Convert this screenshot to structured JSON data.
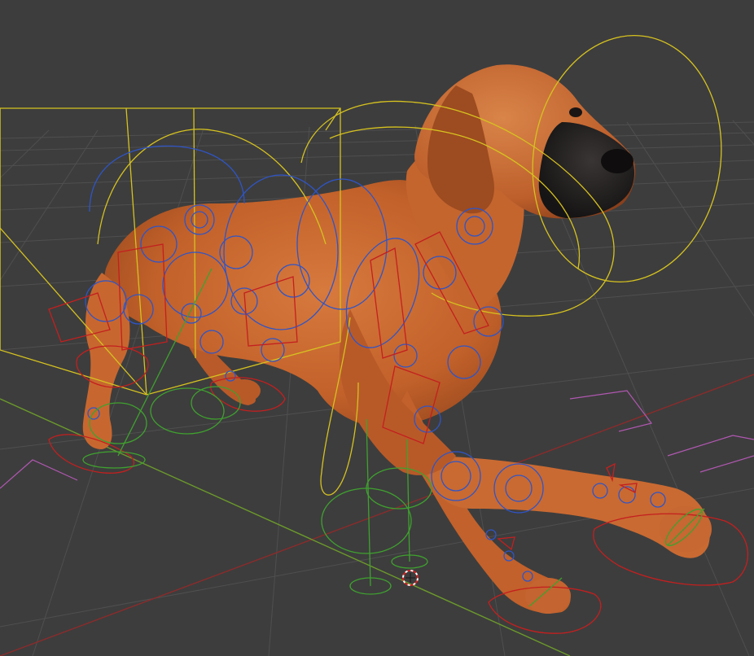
{
  "viewport": {
    "background": "#3d3d3d",
    "grid_color": "#505050",
    "x_axis_color": "#8b2b2b",
    "y_axis_color": "#6c9a2b",
    "cage_color": "#d6c21f",
    "fk_controls_color": "#2f55c7",
    "ik_controls_color": "#c41f1f",
    "foot_roll_color": "#3fa12f",
    "floor_controls_color": "#b058b0",
    "mesh_color": "#c8642c",
    "object": "dog-rig",
    "cursor": "3d-cursor-icon"
  }
}
